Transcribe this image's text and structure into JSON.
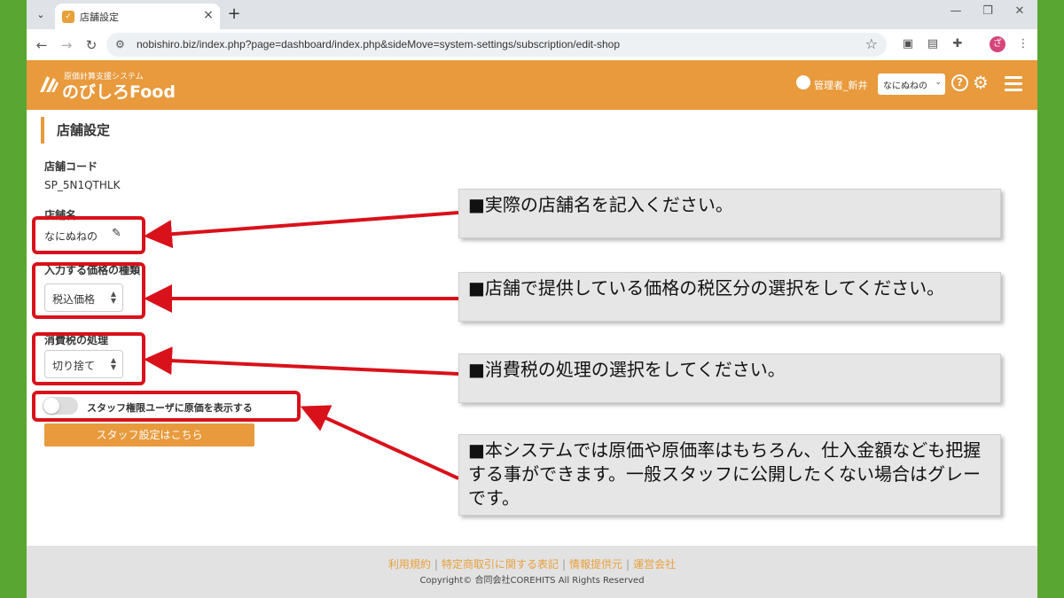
{
  "browser": {
    "tab_title": "店舗設定",
    "url": "nobishiro.biz/index.php?page=dashboard/index.php&sideMove=system-settings/subscription/edit-shop"
  },
  "app": {
    "logo_sub": "原価計算支援システム",
    "logo_main": "のびしろFood",
    "user_name": "管理者_新井",
    "shop_selector": "なにぬねの",
    "accent_color": "#e89a3c"
  },
  "page": {
    "title": "店舗設定",
    "shop_code_label": "店舗コード",
    "shop_code_value": "SP_5N1QTHLK",
    "shop_name_label": "店舗名",
    "shop_name_value": "なにぬねの",
    "price_type_label": "入力する価格の種類",
    "price_type_value": "税込価格",
    "tax_rounding_label": "消費税の処理",
    "tax_rounding_value": "切り捨て",
    "staff_toggle_label": "スタッフ権限ユーザに原価を表示する",
    "staff_button": "スタッフ設定はこちら"
  },
  "annotations": [
    "■実際の店舗名を記入ください。",
    "■店舗で提供している価格の税区分の選択をしてください。",
    "■消費税の処理の選択をしてください。",
    "■本システムでは原価や原価率はもちろん、仕入金額なども把握する事ができます。一般スタッフに公開したくない場合はグレーです。"
  ],
  "footer": {
    "links": [
      "利用規約",
      "特定商取引に関する表記",
      "情報提供元",
      "運営会社"
    ],
    "copyright": "Copyright© 合同会社COREHITS All Rights Reserved"
  }
}
